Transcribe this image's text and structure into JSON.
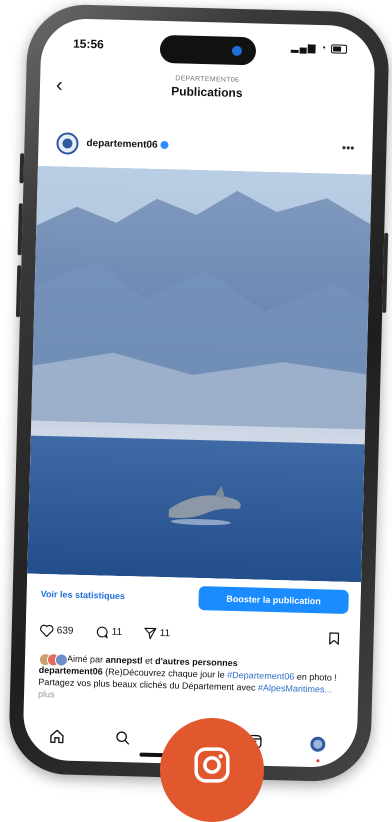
{
  "status_bar": {
    "time": "15:56"
  },
  "header": {
    "subtitle": "DEPARTEMENT06",
    "title": "Publications"
  },
  "post": {
    "username": "departement06",
    "stats_link": "Voir les statistiques",
    "boost_button": "Booster la publication",
    "likes_count": "639",
    "comments_count": "11",
    "shares_count": "11",
    "liked_by_prefix": "Aimé par",
    "liked_by_user": "annepstl",
    "liked_by_mid": "et",
    "liked_by_others": "d'autres personnes",
    "caption_user": "departement06",
    "caption_text_1": "(Re)Découvrez chaque jour le",
    "caption_tag_1": "#Departement06",
    "caption_text_2": "en photo ! Partagez vos plus beaux clichés du Département avec",
    "caption_tag_2": "#AlpesMaritimes...",
    "caption_more": "plus"
  },
  "colors": {
    "accent": "#1a8cff",
    "badge": "#e2582e",
    "sea": "#2c5c9a",
    "mountain": "#6c8bb4"
  },
  "icons": {
    "back": "chevron-left-icon",
    "more": "more-dots-icon",
    "like": "heart-icon",
    "comment": "comment-icon",
    "share": "send-icon",
    "save": "bookmark-icon",
    "tab_home": "home-icon",
    "tab_search": "search-icon",
    "tab_add": "add-icon",
    "tab_reels": "reels-icon",
    "tab_profile": "profile-avatar-icon",
    "badge": "instagram-icon"
  }
}
